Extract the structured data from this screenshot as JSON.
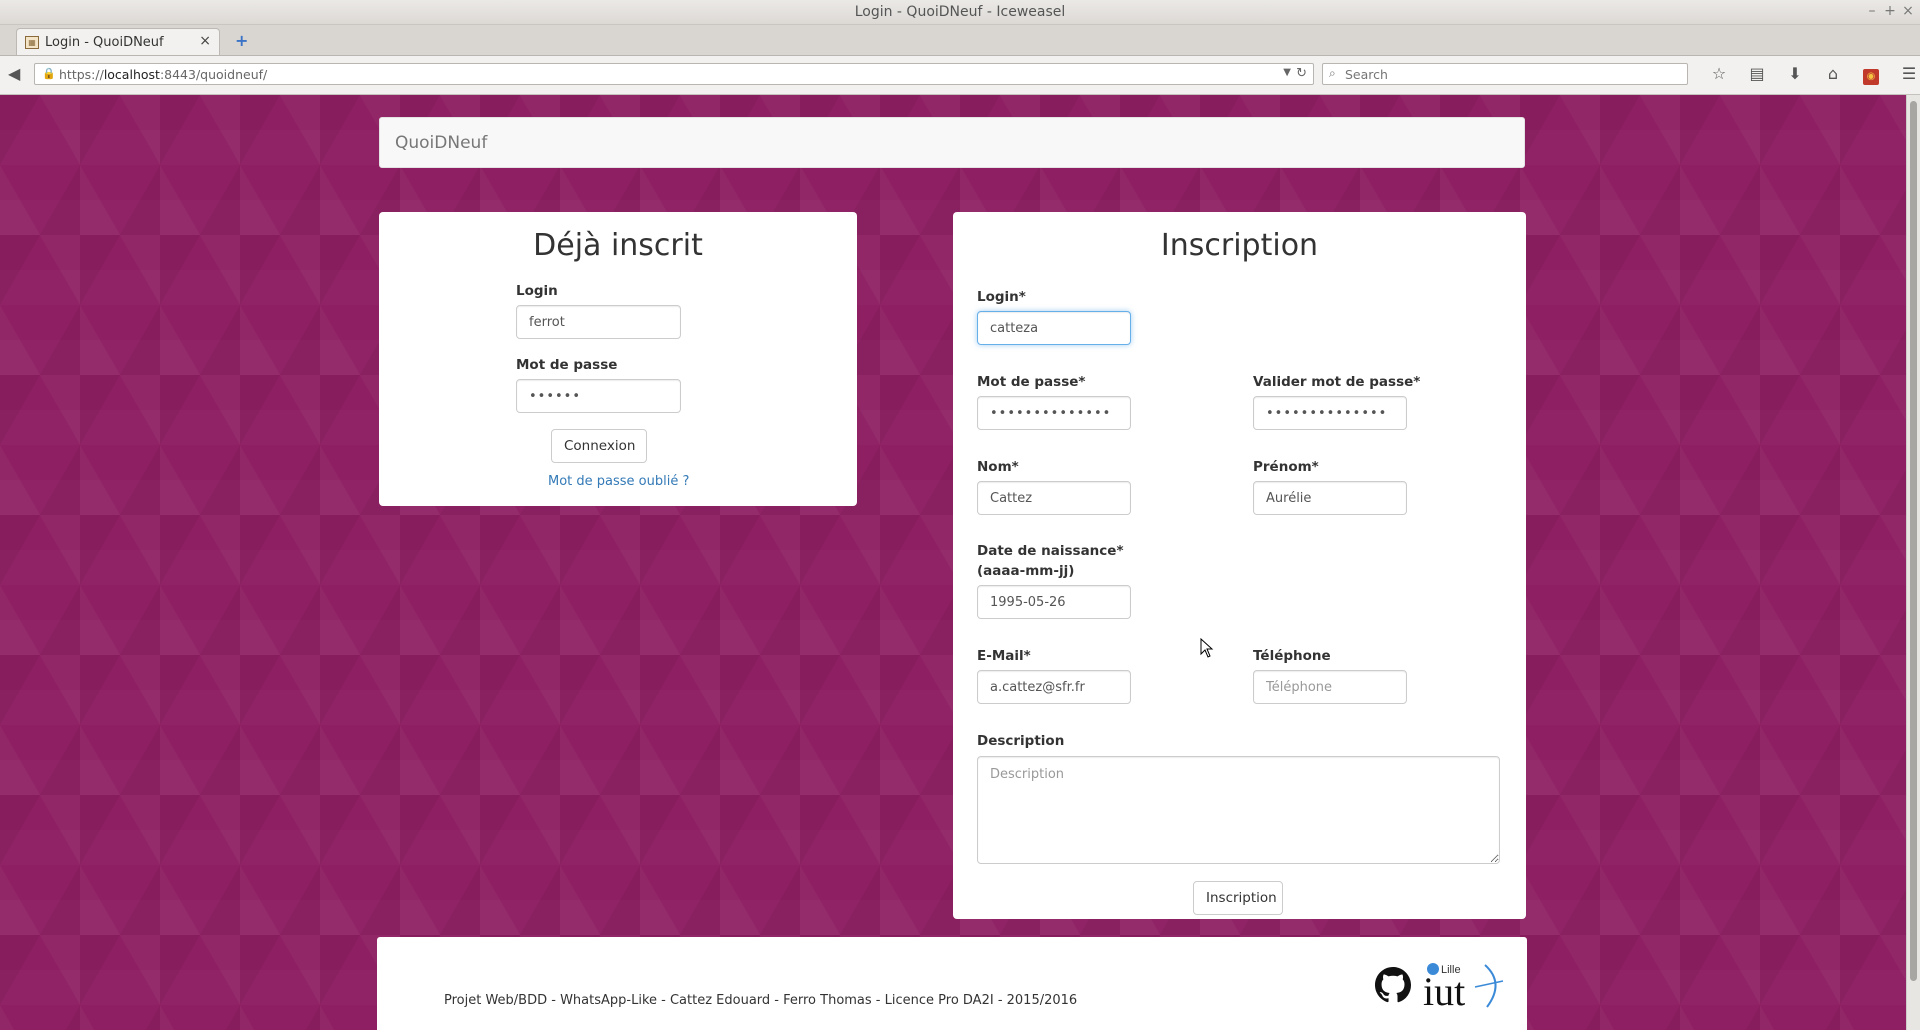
{
  "window": {
    "title": "Login - QuoiDNeuf - Iceweasel",
    "controls": [
      "–",
      "+",
      "×"
    ]
  },
  "tabs": [
    {
      "label": "Login - QuoiDNeuf",
      "close": "×"
    }
  ],
  "new_tab": "+",
  "nav": {
    "url_prefix": "https://",
    "url_host": "localhost",
    "url_rest": ":8443/quoidneuf/",
    "search_placeholder": "Search"
  },
  "brand": "QuoiDNeuf",
  "login_panel": {
    "title": "Déjà inscrit",
    "login_label": "Login",
    "login_value": "ferrot",
    "password_label": "Mot de passe",
    "password_value": "••••••",
    "submit_label": "Connexion",
    "forgot_link": "Mot de passe oublié ?"
  },
  "signup_panel": {
    "title": "Inscription",
    "login_label": "Login*",
    "login_value": "catteza",
    "password_label": "Mot de passe*",
    "password_value": "••••••••••••••",
    "confirm_label": "Valider mot de passe*",
    "confirm_value": "••••••••••••••",
    "nom_label": "Nom*",
    "nom_value": "Cattez",
    "prenom_label": "Prénom*",
    "prenom_value": "Aurélie",
    "birth_label_line1": "Date de naissance*",
    "birth_label_line2": "(aaaa-mm-jj)",
    "birth_value": "1995-05-26",
    "email_label": "E-Mail*",
    "email_value": "a.cattez@sfr.fr",
    "phone_label": "Téléphone",
    "phone_placeholder": "Téléphone",
    "description_label": "Description",
    "description_placeholder": "Description",
    "submit_label": "Inscription"
  },
  "footer": {
    "credits": "Projet Web/BDD - WhatsApp-Like - Cattez Edouard - Ferro Thomas - Licence Pro DA2I - 2015/2016",
    "iut_logo_city": "Lille",
    "iut_logo_text": "iut"
  },
  "colors": {
    "page_background": "#8e1f62",
    "link": "#337ab7",
    "focus": "#66afe9"
  },
  "icons": [
    "back-arrow-icon",
    "lock-icon",
    "reload-icon",
    "search-icon",
    "bookmark-star-icon",
    "reading-list-icon",
    "download-icon",
    "home-icon",
    "addon-icon",
    "menu-icon",
    "github-icon"
  ]
}
